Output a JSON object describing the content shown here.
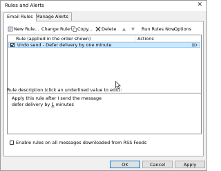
{
  "window": {
    "title": "Rules and Alerts"
  },
  "tabs": [
    {
      "label": "Email Rules",
      "active": true
    },
    {
      "label": "Manage Alerts",
      "active": false
    }
  ],
  "toolbar": {
    "new_rule": "New Rule...",
    "change_rule": "Change Rule",
    "copy": "Copy...",
    "delete": "Delete",
    "run_rules_now": "Run Rules Now...",
    "options": "Options"
  },
  "rules_list": {
    "columns": [
      "Rule (applied in the order shown)",
      "Actions"
    ],
    "rows": [
      {
        "name": "Undo send - Defer delivery by one minute",
        "checked": true,
        "selected": true
      }
    ]
  },
  "description": {
    "label": "Rule description (click an underlined value to edit):",
    "line1": "Apply this rule after I send the message",
    "line2_prefix": "defer delivery by ",
    "line2_value": "1",
    "line2_suffix": " minutes"
  },
  "rss_option": {
    "label": "Enable rules on all messages downloaded from RSS Feeds",
    "checked": false
  },
  "buttons": {
    "ok": "OK",
    "cancel": "Cancel",
    "apply": "Apply"
  },
  "colors": {
    "selection": "#cce8ff",
    "selection_border": "#99d1ff",
    "accent": "#0078d7",
    "delete_x": "#222222"
  },
  "icons": [
    "close-icon",
    "new-rule-icon",
    "change-rule-icon",
    "copy-icon",
    "delete-icon",
    "move-up-icon",
    "move-down-icon",
    "run-rules-icon",
    "rule-action-icon",
    "mouse-cursor-icon"
  ]
}
